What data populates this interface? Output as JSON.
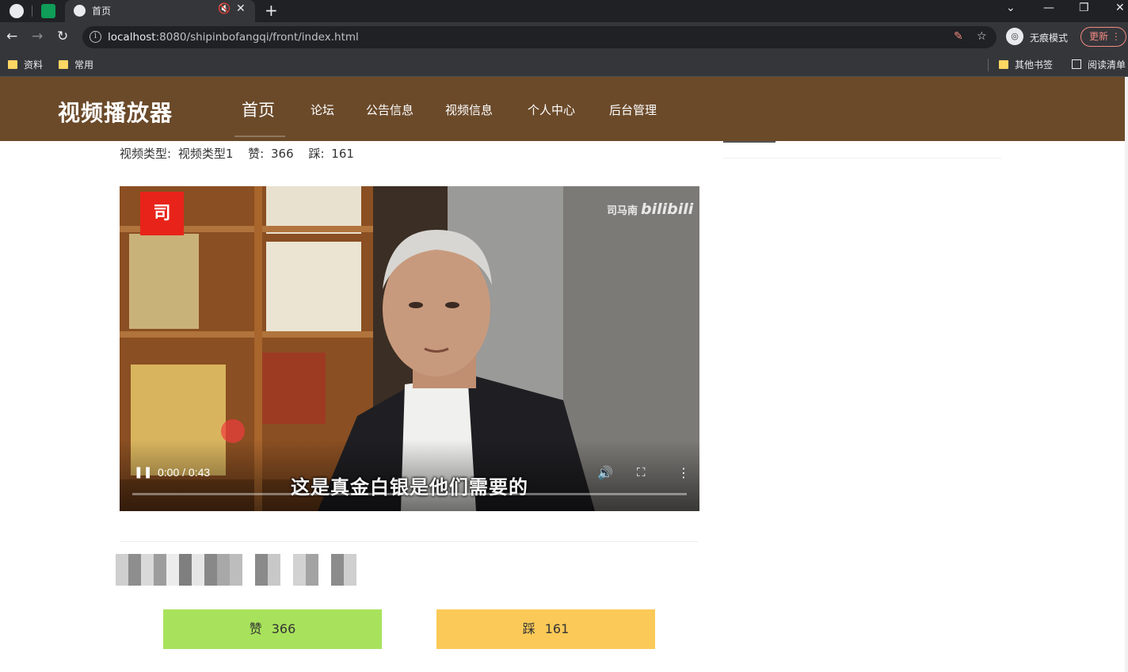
{
  "browser": {
    "tab_title": "首页",
    "url_host": "localhost",
    "url_rest": ":8080/shipinbofangqi/front/index.html",
    "incognito_label": "无痕模式",
    "update_label": "更新",
    "bookmarks": [
      "资料",
      "常用"
    ],
    "bookmarks_right": [
      "其他书签",
      "阅读清单"
    ]
  },
  "site": {
    "brand": "视频播放器",
    "nav": [
      "首页",
      "论坛",
      "公告信息",
      "视频信息",
      "个人中心",
      "后台管理"
    ],
    "active_nav": "首页"
  },
  "video_meta": {
    "type_label": "视频类型:",
    "type_value": "视频类型1",
    "like_label": "赞:",
    "like_count": "366",
    "dislike_label": "踩:",
    "dislike_count": "161"
  },
  "player": {
    "logo_text": "司",
    "watermark_name": "司马南",
    "watermark_brand": "bilibili",
    "subtitle": "这是真金白银是他们需要的",
    "time": "0:00 / 0:43",
    "progress": 0.0
  },
  "actions": {
    "like_label": "赞",
    "like_count": "366",
    "dislike_label": "踩",
    "dislike_count": "161"
  }
}
